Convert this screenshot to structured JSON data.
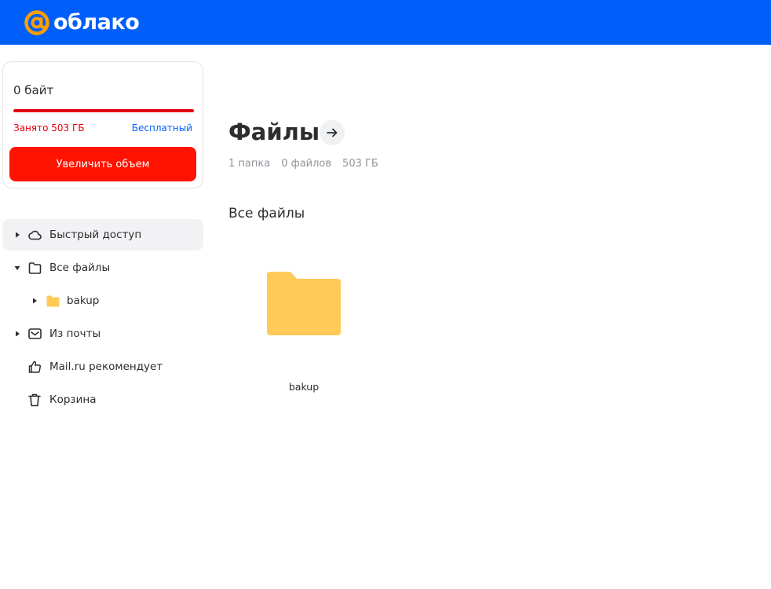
{
  "header": {
    "logo_text": "облако",
    "brand_color": "#005ff9",
    "logo_icon": "at-sign-icon"
  },
  "storage": {
    "size": "0 байт",
    "used": "Занято 503 ГБ",
    "plan": "Бесплатный",
    "usage_fraction": 1.0,
    "upgrade_label": "Увеличить объем",
    "upgrade_color": "#ff1200"
  },
  "sidebar": {
    "items": [
      {
        "label": "Быстрый доступ",
        "icon": "cloud-icon",
        "caret": "right",
        "active": true
      },
      {
        "label": "Все файлы",
        "icon": "folder-outline-icon",
        "caret": "down"
      },
      {
        "label": "bakup",
        "icon": "folder-filled-icon",
        "caret": "right",
        "indent": 1
      },
      {
        "label": "Из почты",
        "icon": "mail-icon",
        "caret": "right"
      },
      {
        "label": "Mail.ru рекомендует",
        "icon": "thumbs-up-icon"
      },
      {
        "label": "Корзина",
        "icon": "trash-icon"
      }
    ]
  },
  "main": {
    "title": "Файлы",
    "stats": {
      "folders": "1 папка",
      "files": "0 файлов",
      "size": "503 ГБ"
    },
    "section_title": "Все файлы",
    "folders": [
      {
        "name": "bakup",
        "color": "#ffca58"
      }
    ]
  }
}
